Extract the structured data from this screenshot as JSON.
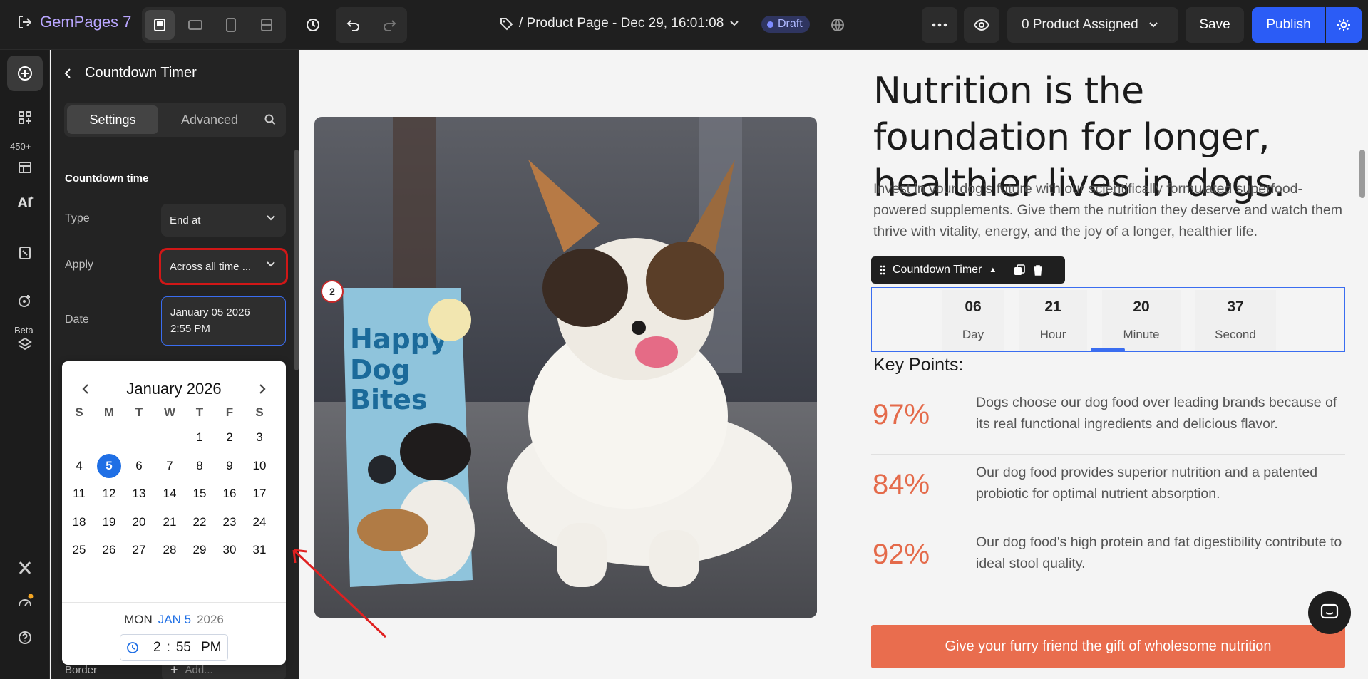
{
  "app": {
    "name": "GemPages 7"
  },
  "topbar": {
    "page_title": "/ Product Page - Dec 29, 16:01:08",
    "status": "Draft",
    "assigned": "0 Product Assigned",
    "save_label": "Save",
    "publish_label": "Publish"
  },
  "rail": {
    "badge": "450+",
    "beta": "Beta"
  },
  "panel": {
    "title": "Countdown Timer",
    "tabs": [
      "Settings",
      "Advanced"
    ],
    "section_title": "Countdown time",
    "type_label": "Type",
    "type_value": "End at",
    "apply_label": "Apply",
    "apply_value": "Across all time ...",
    "date_label": "Date",
    "date_line1": "January 05 2026",
    "date_line2": "2:55 PM",
    "border_label": "Border",
    "border_placeholder": "Add..."
  },
  "calendar": {
    "month_title": "January 2026",
    "weekdays": [
      "S",
      "M",
      "T",
      "W",
      "T",
      "F",
      "S"
    ],
    "first_weekday": 4,
    "days_in_month": 31,
    "selected_day": 5,
    "footer_dow": "MON",
    "footer_md": "JAN 5",
    "footer_year": "2026",
    "time_hour": "2",
    "time_min": "55",
    "time_ampm": "PM"
  },
  "canvas": {
    "step_number": "2",
    "product_bag_text": "Happy Dog Bites",
    "headline": "Nutrition is the foundation for longer, healthier lives in dogs.",
    "subtext": "Invest in your dog's future with our scientifically formulated superfood-powered supplements. Give them the nutrition they deserve and watch them thrive with vitality, energy, and the joy of a longer, healthier life.",
    "countdown_toolbar_label": "Countdown Timer",
    "countdown": [
      {
        "value": "06",
        "label": "Day"
      },
      {
        "value": "21",
        "label": "Hour"
      },
      {
        "value": "20",
        "label": "Minute"
      },
      {
        "value": "37",
        "label": "Second"
      }
    ],
    "key_points_title": "Key Points:",
    "stats": [
      {
        "pct": "97%",
        "text": "Dogs choose our dog food over leading brands because of its real functional ingredients and delicious flavor."
      },
      {
        "pct": "84%",
        "text": "Our dog food provides superior nutrition and a patented probiotic for optimal nutrient absorption."
      },
      {
        "pct": "92%",
        "text": "Our dog food's high protein and fat digestibility contribute to ideal stool quality."
      }
    ],
    "cta_label": "Give your furry friend the gift of wholesome nutrition"
  },
  "colors": {
    "accent": "#2b5cf6",
    "brand_orange": "#e96d4e",
    "highlight_red": "#d01717"
  }
}
